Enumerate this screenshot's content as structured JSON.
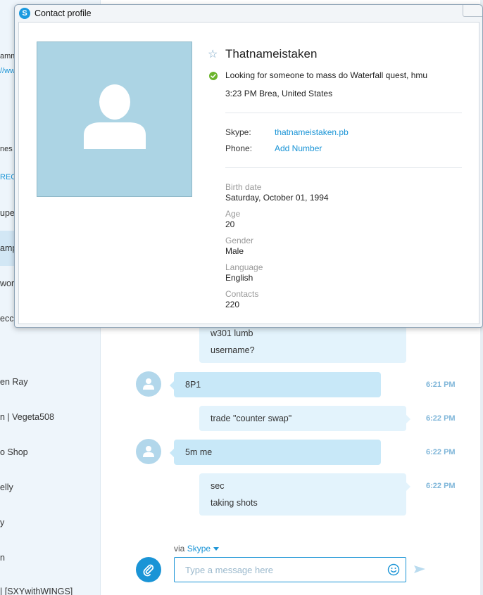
{
  "dialog": {
    "title": "Contact profile",
    "display_name": "Thatnameistaken",
    "mood": "Looking for someone to mass do Waterfall quest, hmu",
    "local_time": "3:23 PM Brea, United States",
    "skype_label": "Skype:",
    "skype_value": "thatnameistaken.pb",
    "phone_label": "Phone:",
    "phone_action": "Add Number",
    "details": [
      {
        "label": "Birth date",
        "value": "Saturday, October 01, 1994"
      },
      {
        "label": "Age",
        "value": "20"
      },
      {
        "label": "Gender",
        "value": "Male"
      },
      {
        "label": "Language",
        "value": "English"
      },
      {
        "label": "Contacts",
        "value": "220"
      }
    ]
  },
  "sidebar": {
    "fragments": [
      "amm",
      "//ww",
      "nes",
      "REC"
    ],
    "items": [
      {
        "label": "upe"
      },
      {
        "label": "amp"
      },
      {
        "label": "wor"
      },
      {
        "label": "ecca"
      },
      {
        "label": "en Ray"
      },
      {
        "label": "n | Vegeta508"
      },
      {
        "label": "o Shop"
      },
      {
        "label": "elly"
      },
      {
        "label": "y"
      },
      {
        "label": "n"
      },
      {
        "label": "| [SXYwithWINGS]"
      }
    ]
  },
  "chat": {
    "messages": [
      {
        "from": "me",
        "lines": [
          "w301 lumb",
          "username?"
        ]
      },
      {
        "from": "contact",
        "lines": [
          "8P1"
        ],
        "time": "6:21 PM"
      },
      {
        "from": "me",
        "lines": [
          "trade \"counter swap\""
        ],
        "time": "6:22 PM"
      },
      {
        "from": "contact",
        "lines": [
          "5m me"
        ],
        "time": "6:22 PM"
      },
      {
        "from": "me",
        "lines": [
          "sec",
          "taking shots"
        ],
        "time": "6:22 PM"
      }
    ],
    "via_prefix": "via",
    "via_service": "Skype",
    "input_placeholder": "Type a message here"
  },
  "icons": {
    "app": "skype-logo-icon",
    "star": "star-outline-icon",
    "status": "online-check-icon",
    "attach": "paperclip-icon",
    "emoji": "smiley-icon",
    "send": "send-arrow-icon"
  },
  "colors": {
    "accent": "#1a94d6",
    "online": "#6cb52c",
    "bubble_contact": "#c8e8f8",
    "bubble_me": "#e3f3fc",
    "avatar_bg": "#acd4e4"
  }
}
